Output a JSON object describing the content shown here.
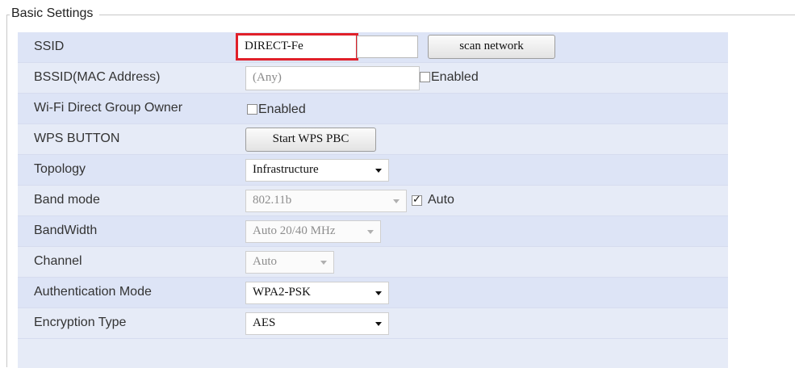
{
  "legend": "Basic Settings",
  "rows": {
    "ssid": {
      "label": "SSID",
      "value": "DIRECT-Fe",
      "button": "scan network"
    },
    "bssid": {
      "label": "BSSID(MAC Address)",
      "placeholder": "(Any)",
      "checkbox_label": "Enabled",
      "checked": false
    },
    "wifi_direct": {
      "label": "Wi-Fi Direct Group Owner",
      "checkbox_label": "Enabled",
      "checked": false
    },
    "wps": {
      "label": "WPS BUTTON",
      "button": "Start WPS PBC"
    },
    "topology": {
      "label": "Topology",
      "value": "Infrastructure"
    },
    "band_mode": {
      "label": "Band mode",
      "value": "802.11b",
      "checkbox_label": "Auto",
      "checked": true
    },
    "bandwidth": {
      "label": "BandWidth",
      "value": "Auto 20/40 MHz"
    },
    "channel": {
      "label": "Channel",
      "value": "Auto"
    },
    "auth": {
      "label": "Authentication Mode",
      "value": "WPA2-PSK"
    },
    "encryption": {
      "label": "Encryption Type",
      "value": "AES"
    }
  },
  "colors": {
    "highlight": "#e0202a",
    "panel": "#e6ebf7"
  }
}
